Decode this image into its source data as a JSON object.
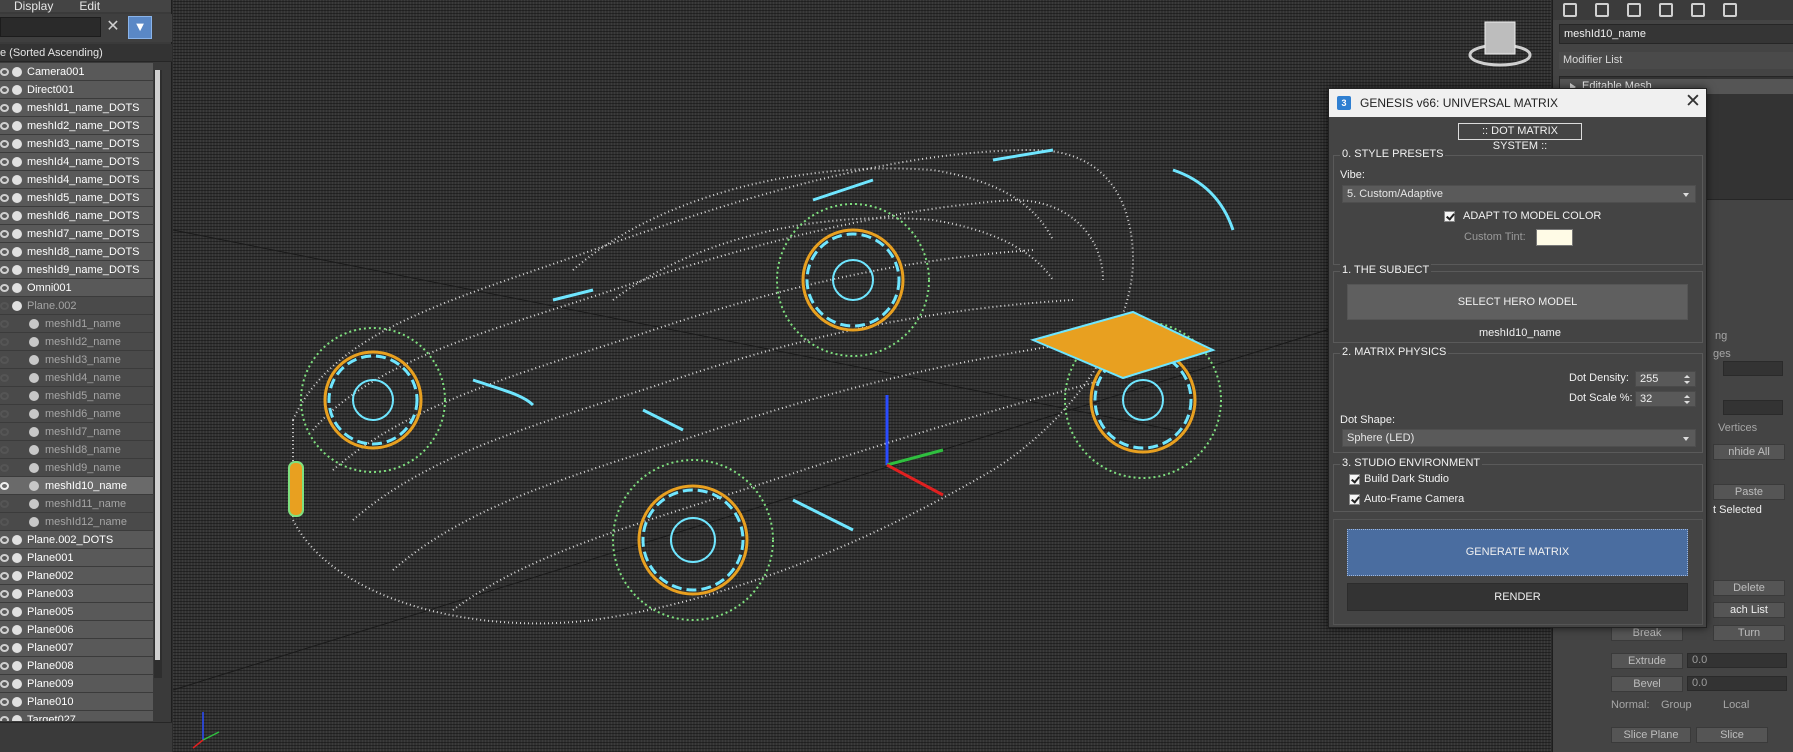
{
  "explorer": {
    "menu": [
      "Display",
      "Edit"
    ],
    "header": "e (Sorted Ascending)",
    "items": [
      {
        "name": "Camera001",
        "level": 0,
        "state": "normal"
      },
      {
        "name": "Direct001",
        "level": 0,
        "state": "normal"
      },
      {
        "name": "meshId1_name_DOTS",
        "level": 0,
        "state": "normal"
      },
      {
        "name": "meshId2_name_DOTS",
        "level": 0,
        "state": "normal"
      },
      {
        "name": "meshId3_name_DOTS",
        "level": 0,
        "state": "normal"
      },
      {
        "name": "meshId4_name_DOTS",
        "level": 0,
        "state": "normal"
      },
      {
        "name": "meshId4_name_DOTS",
        "level": 0,
        "state": "normal"
      },
      {
        "name": "meshId5_name_DOTS",
        "level": 0,
        "state": "normal"
      },
      {
        "name": "meshId6_name_DOTS",
        "level": 0,
        "state": "normal"
      },
      {
        "name": "meshId7_name_DOTS",
        "level": 0,
        "state": "normal"
      },
      {
        "name": "meshId8_name_DOTS",
        "level": 0,
        "state": "normal"
      },
      {
        "name": "meshId9_name_DOTS",
        "level": 0,
        "state": "normal"
      },
      {
        "name": "Omni001",
        "level": 0,
        "state": "normal"
      },
      {
        "name": "Plane.002",
        "level": 0,
        "state": "dim"
      },
      {
        "name": "meshId1_name",
        "level": 1,
        "state": "dim"
      },
      {
        "name": "meshId2_name",
        "level": 1,
        "state": "dim"
      },
      {
        "name": "meshId3_name",
        "level": 1,
        "state": "dim"
      },
      {
        "name": "meshId4_name",
        "level": 1,
        "state": "dim"
      },
      {
        "name": "meshId5_name",
        "level": 1,
        "state": "dim"
      },
      {
        "name": "meshId6_name",
        "level": 1,
        "state": "dim"
      },
      {
        "name": "meshId7_name",
        "level": 1,
        "state": "dim"
      },
      {
        "name": "meshId8_name",
        "level": 1,
        "state": "dim"
      },
      {
        "name": "meshId9_name",
        "level": 1,
        "state": "dim"
      },
      {
        "name": "meshId10_name",
        "level": 1,
        "state": "sel"
      },
      {
        "name": "meshId11_name",
        "level": 1,
        "state": "dim"
      },
      {
        "name": "meshId12_name",
        "level": 1,
        "state": "dim"
      },
      {
        "name": "Plane.002_DOTS",
        "level": 0,
        "state": "normal"
      },
      {
        "name": "Plane001",
        "level": 0,
        "state": "normal"
      },
      {
        "name": "Plane002",
        "level": 0,
        "state": "normal"
      },
      {
        "name": "Plane003",
        "level": 0,
        "state": "normal"
      },
      {
        "name": "Plane005",
        "level": 0,
        "state": "normal"
      },
      {
        "name": "Plane006",
        "level": 0,
        "state": "normal"
      },
      {
        "name": "Plane007",
        "level": 0,
        "state": "normal"
      },
      {
        "name": "Plane008",
        "level": 0,
        "state": "normal"
      },
      {
        "name": "Plane009",
        "level": 0,
        "state": "normal"
      },
      {
        "name": "Plane010",
        "level": 0,
        "state": "normal"
      },
      {
        "name": "Target027",
        "level": 0,
        "state": "normal"
      }
    ]
  },
  "command_panel": {
    "object_name": "meshId10_name",
    "modifier_list": "Modifier List",
    "stack_item": "Editable Mesh",
    "ghost_labels": [
      "ng",
      "ges",
      "Vertices",
      "nhide All",
      "Paste",
      "t Selected",
      "Delete",
      "ach List",
      "Break",
      "Turn",
      "Extrude",
      "Bevel",
      "Normal:",
      "Group",
      "Local",
      "Slice Plane",
      "Slice"
    ],
    "spinner_values": [
      "0.0",
      "0.0"
    ]
  },
  "dialog": {
    "title": "GENESIS v66: UNIVERSAL MATRIX",
    "banner": ":: DOT MATRIX SYSTEM ::",
    "style_presets": {
      "title": "0. STYLE PRESETS",
      "vibe_label": "Vibe:",
      "vibe_value": "5. Custom/Adaptive",
      "adapt_label": "ADAPT TO MODEL COLOR",
      "adapt_checked": true,
      "tint_label": "Custom Tint:",
      "tint_color": "#fffbe6"
    },
    "subject": {
      "title": "1. THE SUBJECT",
      "button": "SELECT HERO MODEL",
      "selected": "meshId10_name"
    },
    "physics": {
      "title": "2. MATRIX PHYSICS",
      "density_label": "Dot Density:",
      "density_value": "255",
      "scale_label": "Dot Scale %:",
      "scale_value": "32",
      "shape_label": "Dot Shape:",
      "shape_value": "Sphere (LED)"
    },
    "environment": {
      "title": "3. STUDIO ENVIRONMENT",
      "dark_studio_label": "Build Dark Studio",
      "dark_studio_checked": true,
      "auto_frame_label": "Auto-Frame Camera",
      "auto_frame_checked": true
    },
    "generate_button": "GENERATE MATRIX",
    "render_button": "RENDER"
  },
  "colors": {
    "accent_blue": "#4a6da0",
    "wire_cyan": "#6fe6ff",
    "wire_green": "#7fe07f",
    "wire_orange": "#e8a020"
  }
}
